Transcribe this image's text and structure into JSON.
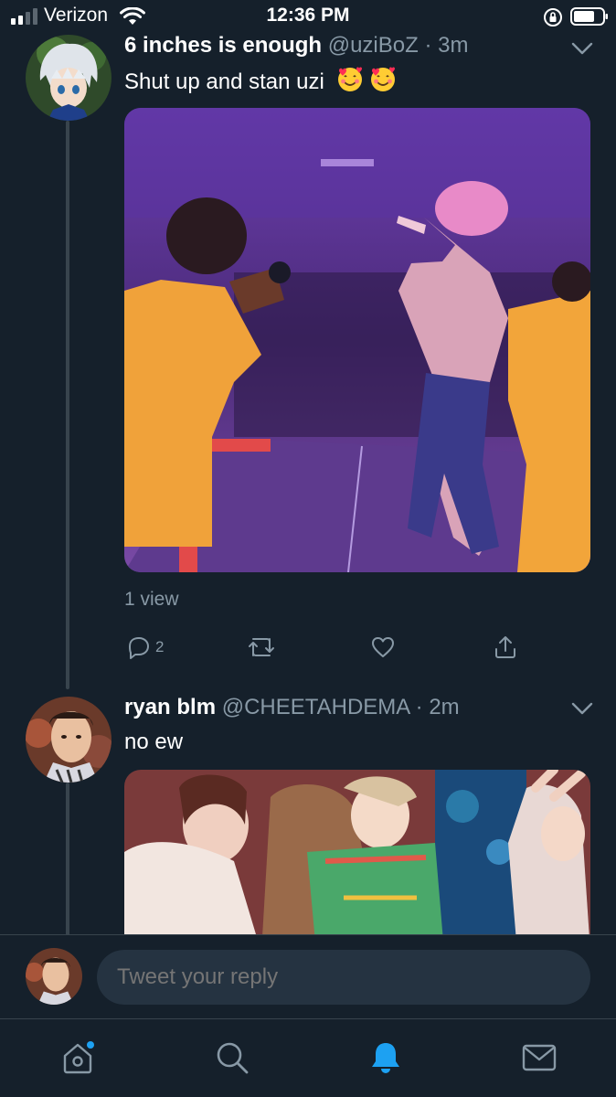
{
  "status_bar": {
    "carrier": "Verizon",
    "time": "12:36 PM"
  },
  "tweets": [
    {
      "display_name": "6 inches is enough",
      "handle": "@uziBoZ",
      "separator": "·",
      "age": "3m",
      "text": "Shut up and stan uzi",
      "emojis": [
        "smiling-face-with-hearts",
        "smiling-face-with-hearts"
      ],
      "views": "1 view",
      "reply_count": "2"
    },
    {
      "display_name": "ryan blm",
      "handle": "@CHEETAHDEMA",
      "separator": "·",
      "age": "2m",
      "text": "no ew"
    }
  ],
  "reply_bar": {
    "placeholder": "Tweet your reply"
  },
  "tab_bar": {
    "items": [
      "home",
      "search",
      "notifications",
      "messages"
    ],
    "active": "notifications"
  },
  "colors": {
    "background": "#15202b",
    "accent": "#1da1f2",
    "muted": "#8899a6",
    "divider": "#38444d"
  }
}
